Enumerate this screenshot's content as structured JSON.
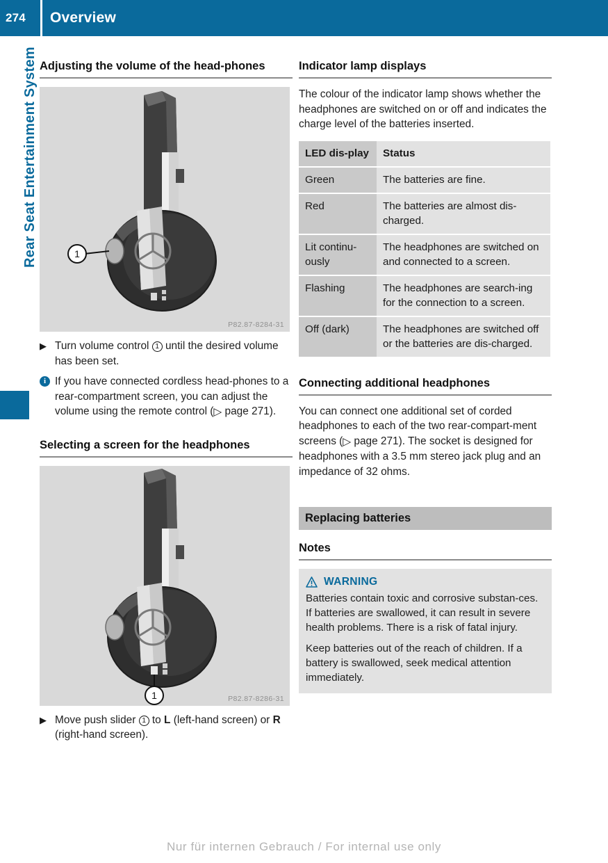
{
  "header": {
    "page_number": "274",
    "title": "Overview"
  },
  "chapter_tab": {
    "label": "Rear Seat Entertainment System"
  },
  "left_column": {
    "heading": "Adjusting the volume of the head-phones",
    "figure1": {
      "image_code": "P82.87-8284-31",
      "callout": "1",
      "alt_name": "cordless-headphones-volume-control"
    },
    "step1": {
      "marker": "▶",
      "text_before": "Turn volume control",
      "callout": "1",
      "text_after": "until the desired volume has been set."
    },
    "note1": {
      "icon": "info-icon",
      "text_before": "If you have connected cordless head-phones to a rear-compartment screen, you can adjust the volume using the remote control (",
      "ref_arrow": "▷",
      "ref_text": "page 271",
      "text_after": ")."
    },
    "heading2": "Selecting a screen for the headphones",
    "figure2": {
      "image_code": "P82.87-8286-31",
      "callout": "1",
      "alt_name": "cordless-headphones-push-slider"
    },
    "step2": {
      "marker": "▶",
      "text_before": "Move push slider",
      "callout": "1",
      "text_mid": "to",
      "bold1": "L",
      "text_mid2": "(left-hand screen) or",
      "bold2": "R",
      "text_after": "(right-hand screen)."
    }
  },
  "right_column": {
    "heading1": "Indicator lamp displays",
    "intro": "The colour of the indicator lamp shows whether the headphones are switched on or off and indicates the charge level of the batteries inserted.",
    "table": {
      "columns": [
        "LED dis-play",
        "Status"
      ],
      "rows": [
        [
          "Green",
          "The batteries are fine."
        ],
        [
          "Red",
          "The batteries are almost dis-charged."
        ],
        [
          "Lit continu-ously",
          "The headphones are switched on and connected to a screen."
        ],
        [
          "Flashing",
          "The headphones are search-ing for the connection to a screen."
        ],
        [
          "Off (dark)",
          "The headphones are switched off or the batteries are dis-charged."
        ]
      ]
    },
    "heading2": "Connecting additional headphones",
    "para2_before": "You can connect one additional set of corded headphones to each of the two rear-compart-ment screens (",
    "para2_ref_arrow": "▷",
    "para2_ref": "page 271",
    "para2_after": "). The socket is designed for headphones with a 3.5 mm stereo jack plug and an impedance of 32 ohms.",
    "band_heading": "Replacing batteries",
    "heading3": "Notes",
    "warning": {
      "icon": "warning-triangle-icon",
      "title": "WARNING",
      "paragraph1": "Batteries contain toxic and corrosive substan-ces. If batteries are swallowed, it can result in severe health problems. There is a risk of fatal injury.",
      "paragraph2": "Keep batteries out of the reach of children. If a battery is swallowed, seek medical attention immediately."
    }
  },
  "footer": {
    "text": "Nur für internen Gebrauch / For internal use only"
  },
  "colors": {
    "brand_blue": "#0a6a9c",
    "band_gray": "#bdbdbd",
    "table_col1": "#c9c9c9",
    "table_col2": "#e2e2e2",
    "figure_bg": "#d9d9d9"
  }
}
